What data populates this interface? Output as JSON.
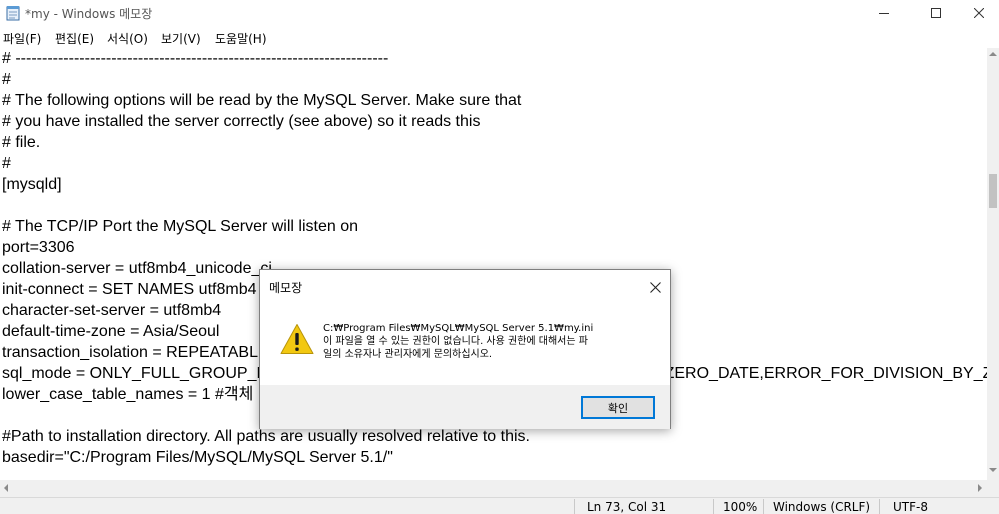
{
  "window": {
    "title": "*my - Windows 메모장"
  },
  "menu": [
    {
      "label": "파일(F)"
    },
    {
      "label": "편집(E)"
    },
    {
      "label": "서식(O)"
    },
    {
      "label": "보기(V)"
    },
    {
      "label": "도움말(H)"
    }
  ],
  "editor": {
    "lines": [
      "# ----------------------------------------------------------------------",
      "#",
      "# The following options will be read by the MySQL Server. Make sure that",
      "# you have installed the server correctly (see above) so it reads this",
      "# file.",
      "#",
      "[mysqld]",
      "",
      "# The TCP/IP Port the MySQL Server will listen on",
      "port=3306",
      "collation-server = utf8mb4_unicode_ci",
      "init-connect = SET NAMES utf8mb4",
      "character-set-server = utf8mb4",
      "default-time-zone = Asia/Seoul",
      "transaction_isolation = REPEATABLE-READ",
      "sql_mode = ONLY_FULL_GROUP_BY,STRICT_TRANS_TABLES,NO_ZERO_IN_DATE,NO_ZERO_DATE,ERROR_FOR_DIVISION_BY_ZERO",
      "lower_case_table_names = 1 #객체",
      "",
      "#Path to installation directory. All paths are usually resolved relative to this.",
      "basedir=\"C:/Program Files/MySQL/MySQL Server 5.1/\""
    ]
  },
  "status": {
    "position": "Ln 73, Col 31",
    "zoom": "100%",
    "line_ending": "Windows (CRLF)",
    "encoding": "UTF-8"
  },
  "dialog": {
    "title": "메모장",
    "message": "C:₩Program Files₩MySQL₩MySQL Server 5.1₩my.ini\n이 파일을 열 수 있는 권한이 없습니다. 사용 권한에 대해서는 파\n일의 소유자나 관리자에게 문의하십시오.",
    "ok_label": "확인",
    "icon": "warning-icon"
  },
  "colors": {
    "accent": "#0078d7",
    "warning": "#f2c811"
  }
}
